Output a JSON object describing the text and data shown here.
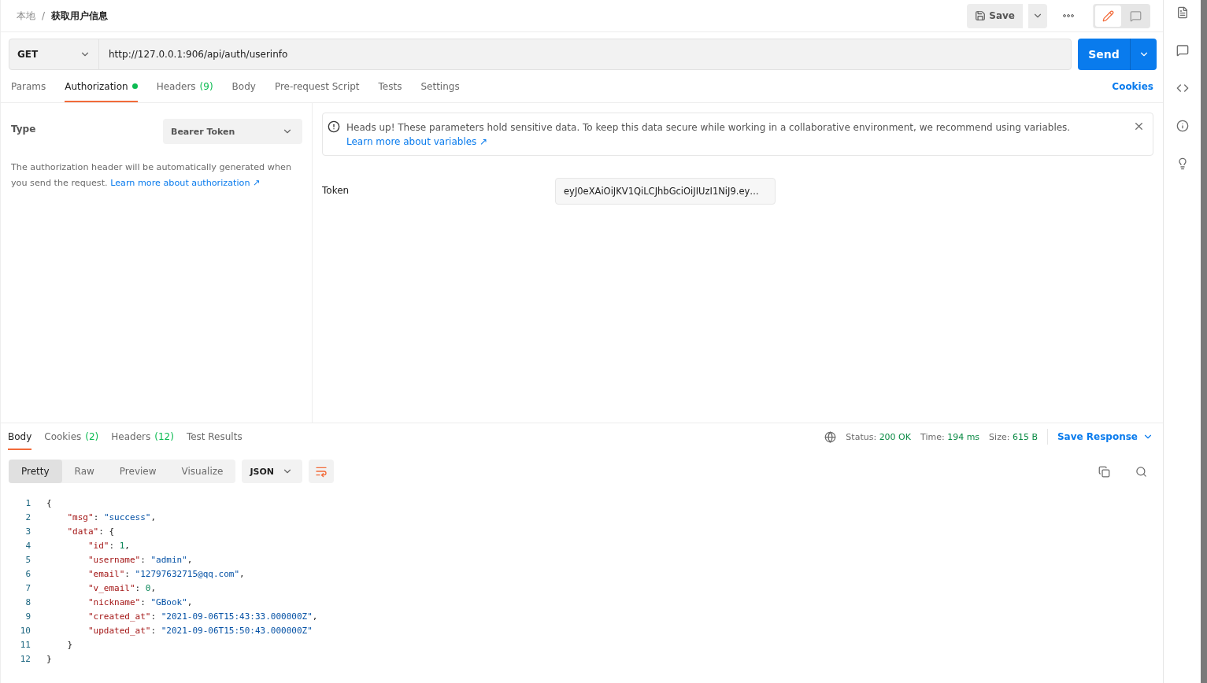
{
  "breadcrumb": {
    "parent": "本地",
    "separator": "/",
    "current": "获取用户信息"
  },
  "toolbar": {
    "save": "Save"
  },
  "mode_toggle": [
    {
      "kind": "edit",
      "selected": true
    },
    {
      "kind": "comment",
      "selected": false
    }
  ],
  "request": {
    "method": "GET",
    "url": "http://127.0.0.1:906/api/auth/userinfo",
    "send": "Send"
  },
  "request_tabs": [
    {
      "label": "Params",
      "selected": false,
      "dot": false
    },
    {
      "label": "Authorization",
      "selected": true,
      "dot": true
    },
    {
      "label": "Headers",
      "count": "(9)",
      "selected": false,
      "dot": false
    },
    {
      "label": "Body",
      "selected": false,
      "dot": false
    },
    {
      "label": "Pre-request Script",
      "selected": false,
      "dot": false
    },
    {
      "label": "Tests",
      "selected": false,
      "dot": false
    },
    {
      "label": "Settings",
      "selected": false,
      "dot": false
    }
  ],
  "cookies_link": "Cookies",
  "auth": {
    "type_label": "Type",
    "type_value": "Bearer Token",
    "description": "The authorization header will be automatically generated when you send the request.",
    "link": "Learn more about authorization ↗"
  },
  "notice": {
    "text": "Heads up! These parameters hold sensitive data. To keep this data secure while working in a collaborative environment, we recommend using variables.",
    "link": "Learn more about variables ↗"
  },
  "token": {
    "label": "Token",
    "value": "eyJ0eXAiOiJKV1QiLCJhbGciOiJIUzI1NiJ9.ey…"
  },
  "response_tabs": [
    {
      "label": "Body",
      "selected": true
    },
    {
      "label": "Cookies",
      "count": "(2)",
      "selected": false
    },
    {
      "label": "Headers",
      "count": "(12)",
      "selected": false
    },
    {
      "label": "Test Results",
      "selected": false
    }
  ],
  "status": [
    {
      "label": "Status:",
      "value": "200 OK"
    },
    {
      "label": "Time:",
      "value": "194 ms"
    },
    {
      "label": "Size:",
      "value": "615 B"
    }
  ],
  "save_response": "Save Response",
  "view_modes": [
    {
      "label": "Pretty",
      "selected": true
    },
    {
      "label": "Raw",
      "selected": false
    },
    {
      "label": "Preview",
      "selected": false
    },
    {
      "label": "Visualize",
      "selected": false
    }
  ],
  "format": "JSON",
  "code_lines": [
    {
      "number": "1",
      "text": "{"
    },
    {
      "number": "2",
      "text": "    \"msg\": \"success\","
    },
    {
      "number": "3",
      "text": "    \"data\": {"
    },
    {
      "number": "4",
      "text": "        \"id\": 1,"
    },
    {
      "number": "5",
      "text": "        \"username\": \"admin\","
    },
    {
      "number": "6",
      "text": "        \"email\": \"12797632715@qq.com\","
    },
    {
      "number": "7",
      "text": "        \"v_email\": 0,"
    },
    {
      "number": "8",
      "text": "        \"nickname\": \"GBook\","
    },
    {
      "number": "9",
      "text": "        \"created_at\": \"2021-09-06T15:43:33.000000Z\","
    },
    {
      "number": "10",
      "text": "        \"updated_at\": \"2021-09-06T15:50:43.000000Z\""
    },
    {
      "number": "11",
      "text": "    }"
    },
    {
      "number": "12",
      "text": "}"
    }
  ]
}
